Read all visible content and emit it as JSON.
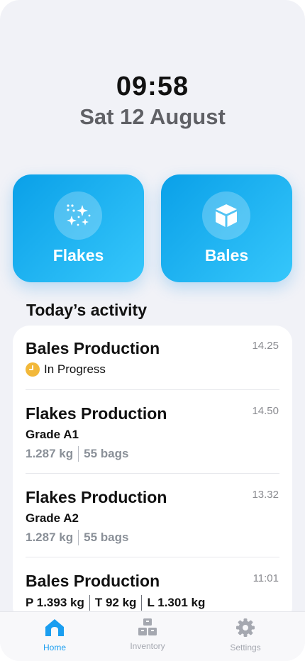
{
  "clock": {
    "time": "09:58",
    "date": "Sat 12 August"
  },
  "tiles": [
    {
      "label": "Flakes",
      "icon": "sparkles-icon"
    },
    {
      "label": "Bales",
      "icon": "cube-icon"
    }
  ],
  "activity": {
    "title": "Today’s activity",
    "items": [
      {
        "title": "Bales Production",
        "time": "14.25",
        "status": "In Progress"
      },
      {
        "title": "Flakes Production",
        "time": "14.50",
        "grade": "Grade A1",
        "weight": "1.287 kg",
        "bags": "55 bags"
      },
      {
        "title": "Flakes Production",
        "time": "13.32",
        "grade": "Grade A2",
        "weight": "1.287 kg",
        "bags": "55 bags"
      },
      {
        "title": "Bales Production",
        "time": "11:01",
        "p": "P 1.393 kg",
        "t": "T 92 kg",
        "l": "L 1.301 kg"
      }
    ]
  },
  "tabs": [
    {
      "label": "Home",
      "icon": "home-icon",
      "active": true
    },
    {
      "label": "Inventory",
      "icon": "boxes-icon",
      "active": false
    },
    {
      "label": "Settings",
      "icon": "gear-icon",
      "active": false
    }
  ],
  "colors": {
    "accent": "#1a9ef0",
    "tile_start": "#0aa0e8",
    "tile_end": "#36c7fb",
    "in_progress": "#f2b83a"
  }
}
